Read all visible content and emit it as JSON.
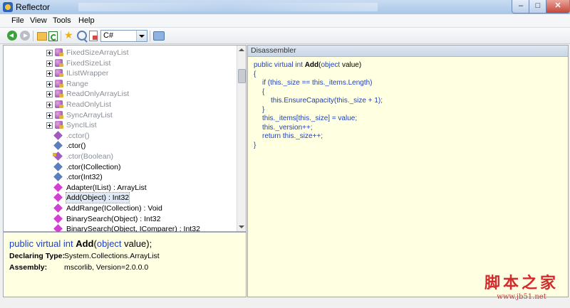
{
  "window": {
    "title": "Reflector",
    "min_icon": "minimize-icon",
    "max_icon": "maximize-icon",
    "close_icon": "close-icon"
  },
  "menu": {
    "items": [
      "File",
      "View",
      "Tools",
      "Help"
    ]
  },
  "toolbar": {
    "language": "C#"
  },
  "tree": {
    "rows": [
      {
        "label": "FixedSizeArrayList",
        "gray": true,
        "expandable": true,
        "icon": "class"
      },
      {
        "label": "FixedSizeList",
        "gray": true,
        "expandable": true,
        "icon": "class"
      },
      {
        "label": "IListWrapper",
        "gray": true,
        "expandable": true,
        "icon": "class"
      },
      {
        "label": "Range",
        "gray": true,
        "expandable": true,
        "icon": "class"
      },
      {
        "label": "ReadOnlyArrayList",
        "gray": true,
        "expandable": true,
        "icon": "class"
      },
      {
        "label": "ReadOnlyList",
        "gray": true,
        "expandable": true,
        "icon": "class"
      },
      {
        "label": "SyncArrayList",
        "gray": true,
        "expandable": true,
        "icon": "class"
      },
      {
        "label": "SyncIList",
        "gray": true,
        "expandable": true,
        "icon": "class"
      },
      {
        "label": ".cctor()",
        "gray": true,
        "expandable": false,
        "icon": "method-static"
      },
      {
        "label": ".ctor()",
        "gray": false,
        "expandable": false,
        "icon": "method-blue"
      },
      {
        "label": ".ctor(Boolean)",
        "gray": true,
        "expandable": false,
        "icon": "method-lock"
      },
      {
        "label": ".ctor(ICollection)",
        "gray": false,
        "expandable": false,
        "icon": "method-blue"
      },
      {
        "label": ".ctor(Int32)",
        "gray": false,
        "expandable": false,
        "icon": "method-blue"
      },
      {
        "label": "Adapter(IList) : ArrayList",
        "gray": false,
        "expandable": false,
        "icon": "method-magenta"
      },
      {
        "label": "Add(Object) : Int32",
        "gray": false,
        "expandable": false,
        "icon": "method-magenta",
        "selected": true
      },
      {
        "label": "AddRange(ICollection) : Void",
        "gray": false,
        "expandable": false,
        "icon": "method-magenta"
      },
      {
        "label": "BinarySearch(Object) : Int32",
        "gray": false,
        "expandable": false,
        "icon": "method-magenta"
      },
      {
        "label": "BinarySearch(Object, IComparer) : Int32",
        "gray": false,
        "expandable": false,
        "icon": "method-magenta"
      }
    ]
  },
  "info": {
    "sig_prefix": "public virtual int ",
    "sig_name": "Add",
    "sig_paren_open": "(",
    "sig_param_type": "object",
    "sig_param_rest": " value);",
    "declaring_type_label": "Declaring Type:",
    "declaring_type": "System.Collections.ArrayList",
    "assembly_label": "Assembly:",
    "assembly": "mscorlib, Version=2.0.0.0"
  },
  "disassembler": {
    "header": "Disassembler",
    "lines": [
      {
        "indent": 0,
        "kw": "public virtual int ",
        "fn": "Add",
        "rest": "(",
        "kw2": "object",
        "tail": " value)"
      },
      {
        "indent": 0,
        "kw": "{",
        "fn": "",
        "rest": "",
        "kw2": "",
        "tail": ""
      },
      {
        "indent": 1,
        "kw": "if (this._size == this._items.Length)",
        "fn": "",
        "rest": "",
        "kw2": "",
        "tail": ""
      },
      {
        "indent": 1,
        "kw": "{",
        "fn": "",
        "rest": "",
        "kw2": "",
        "tail": ""
      },
      {
        "indent": 2,
        "kw": "this.EnsureCapacity(this._size + 1);",
        "fn": "",
        "rest": "",
        "kw2": "",
        "tail": ""
      },
      {
        "indent": 1,
        "kw": "}",
        "fn": "",
        "rest": "",
        "kw2": "",
        "tail": ""
      },
      {
        "indent": 1,
        "kw": "this._items[this._size] = value;",
        "fn": "",
        "rest": "",
        "kw2": "",
        "tail": ""
      },
      {
        "indent": 1,
        "kw": "this._version++;",
        "fn": "",
        "rest": "",
        "kw2": "",
        "tail": ""
      },
      {
        "indent": 1,
        "kw": "return this._size++;",
        "fn": "",
        "rest": "",
        "kw2": "",
        "tail": ""
      },
      {
        "indent": 0,
        "kw": "}",
        "fn": "",
        "rest": "",
        "kw2": "",
        "tail": ""
      }
    ]
  },
  "watermark": {
    "cn": "脚本之家",
    "url": "www.jb51.net"
  }
}
